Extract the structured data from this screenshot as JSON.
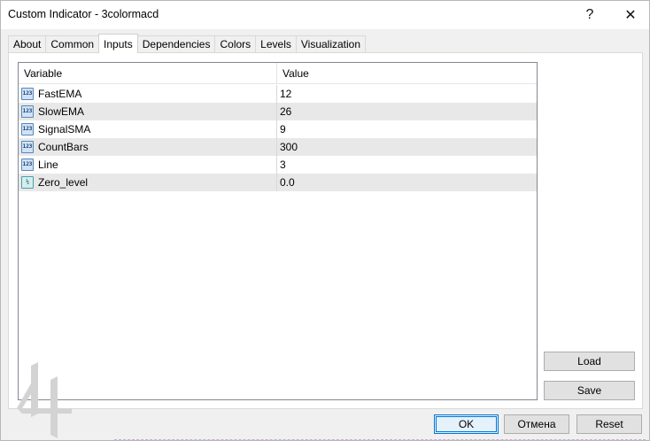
{
  "window": {
    "title": "Custom Indicator - 3colormacd",
    "help_label": "?",
    "close_label": "✕"
  },
  "tabs": [
    {
      "label": "About"
    },
    {
      "label": "Common"
    },
    {
      "label": "Inputs",
      "active": true
    },
    {
      "label": "Dependencies"
    },
    {
      "label": "Colors"
    },
    {
      "label": "Levels"
    },
    {
      "label": "Visualization"
    }
  ],
  "grid": {
    "header": {
      "variable": "Variable",
      "value": "Value"
    },
    "rows": [
      {
        "icon": "int-icon",
        "icon_text": "123",
        "name": "FastEMA",
        "value": "12"
      },
      {
        "icon": "int-icon",
        "icon_text": "123",
        "name": "SlowEMA",
        "value": "26"
      },
      {
        "icon": "int-icon",
        "icon_text": "123",
        "name": "SignalSMA",
        "value": "9"
      },
      {
        "icon": "int-icon",
        "icon_text": "123",
        "name": "CountBars",
        "value": "300"
      },
      {
        "icon": "int-icon",
        "icon_text": "123",
        "name": "Line",
        "value": "3"
      },
      {
        "icon": "double-icon",
        "icon_text": "½",
        "name": "Zero_level",
        "value": "0.0"
      }
    ]
  },
  "side_buttons": {
    "load": "Load",
    "save": "Save"
  },
  "footer_buttons": {
    "ok": "OK",
    "cancel": "Отмена",
    "reset": "Reset"
  },
  "colors": {
    "accent": "#0078d7",
    "row_alt": "#e8e8e8"
  }
}
